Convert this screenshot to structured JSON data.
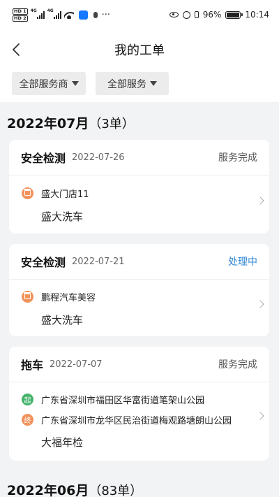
{
  "status_bar": {
    "sim1": "HD 1",
    "sim2": "HD 2",
    "net1": "4G",
    "net2": "4G",
    "battery_text": "96%",
    "battery_level": 0.96,
    "time": "10:14"
  },
  "header": {
    "title": "我的工单"
  },
  "filters": {
    "provider": "全部服务商",
    "service": "全部服务"
  },
  "groups": [
    {
      "month": "2022年07月",
      "count": "（3单）"
    },
    {
      "month": "2022年06月",
      "count": "（83单）"
    }
  ],
  "orders": [
    {
      "service": "安全检测",
      "date": "2022-07-26",
      "status": "服务完成",
      "shop": "盛大门店11",
      "business": "盛大洗车"
    },
    {
      "service": "安全检测",
      "date": "2022-07-21",
      "status": "处理中",
      "shop": "鹏程汽车美容",
      "business": "盛大洗车"
    },
    {
      "service": "拖车",
      "date": "2022-07-07",
      "status": "服务完成",
      "from_badge": "起",
      "from": "广东省深圳市福田区华富街道笔架山公园",
      "to_badge": "终",
      "to": "广东省深圳市龙华区民治街道梅观路塘朗山公园",
      "business": "大福年检"
    }
  ],
  "colors": {
    "processing": "#2f86d6",
    "start_badge": "#44b36b",
    "end_badge": "#f2935d"
  }
}
